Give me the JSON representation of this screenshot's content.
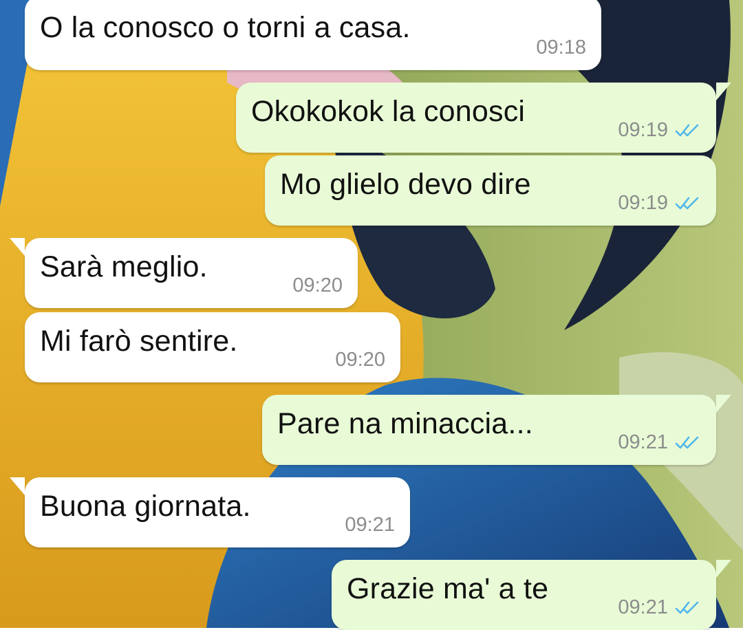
{
  "wallpaper": {
    "description_icon": "macaw-parrot-wallpaper",
    "colors": {
      "yellow": "#e8b22a",
      "blue": "#1f5fa8",
      "dark_blue": "#1a2745",
      "green": "#a9bd6a",
      "pink": "#e8b9c8"
    }
  },
  "messages": [
    {
      "direction": "in",
      "text": "O la conosco o torni a casa.",
      "time": "09:18"
    },
    {
      "direction": "out",
      "text": "Okokokok la conosci",
      "time": "09:19",
      "status": "read"
    },
    {
      "direction": "out",
      "text": "Mo glielo devo dire",
      "time": "09:19",
      "status": "read"
    },
    {
      "direction": "in",
      "text": "Sarà meglio.",
      "time": "09:20"
    },
    {
      "direction": "in",
      "text": "Mi farò sentire.",
      "time": "09:20"
    },
    {
      "direction": "out",
      "text": "Pare na minaccia...",
      "time": "09:21",
      "status": "read"
    },
    {
      "direction": "in",
      "text": "Buona giornata.",
      "time": "09:21"
    },
    {
      "direction": "out",
      "text": "Grazie ma' a te",
      "time": "09:21",
      "status": "read"
    }
  ],
  "colors": {
    "incoming_bubble": "#ffffff",
    "outgoing_bubble": "#e8fbd6",
    "timestamp": "#8c8c8c",
    "read_ticks": "#4fb6ec"
  },
  "icons": {
    "read_status": "double-check-icon"
  }
}
